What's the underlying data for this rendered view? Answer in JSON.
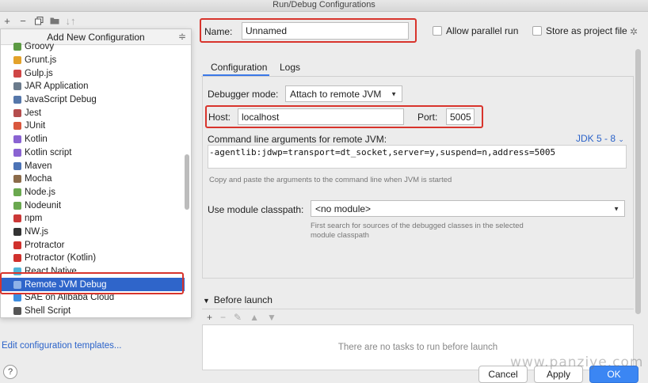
{
  "window": {
    "title": "Run/Debug Configurations"
  },
  "left_toolbar": {
    "icons": [
      "plus-icon",
      "minus-icon",
      "copy-icon",
      "folder-icon",
      "sort-icon"
    ]
  },
  "popup": {
    "title": "Add New Configuration",
    "items": [
      {
        "label": "Groovy",
        "color": "#5c9a43"
      },
      {
        "label": "Grunt.js",
        "color": "#e3a22a"
      },
      {
        "label": "Gulp.js",
        "color": "#cf4646"
      },
      {
        "label": "JAR Application",
        "color": "#6b7b8c"
      },
      {
        "label": "JavaScript Debug",
        "color": "#5577aa"
      },
      {
        "label": "Jest",
        "color": "#b44d4d"
      },
      {
        "label": "JUnit",
        "color": "#d9573e"
      },
      {
        "label": "Kotlin",
        "color": "#8a63d2"
      },
      {
        "label": "Kotlin script",
        "color": "#8a63d2"
      },
      {
        "label": "Maven",
        "color": "#4c73b6"
      },
      {
        "label": "Mocha",
        "color": "#8b6b4a"
      },
      {
        "label": "Node.js",
        "color": "#6aa84f"
      },
      {
        "label": "Nodeunit",
        "color": "#6aa84f"
      },
      {
        "label": "npm",
        "color": "#cb3837"
      },
      {
        "label": "NW.js",
        "color": "#333333"
      },
      {
        "label": "Protractor",
        "color": "#d0312d"
      },
      {
        "label": "Protractor (Kotlin)",
        "color": "#d0312d"
      },
      {
        "label": "React Native",
        "color": "#4fb5d8"
      },
      {
        "label": "Remote JVM Debug",
        "color": "#8fb2e8"
      },
      {
        "label": "SAE on Alibaba Cloud",
        "color": "#3d8de0"
      },
      {
        "label": "Shell Script",
        "color": "#555555"
      }
    ],
    "selected_index": 18
  },
  "templates_link": "Edit configuration templates...",
  "help": "?",
  "name_label": "Name:",
  "name_value": "Unnamed",
  "allow_parallel": "Allow parallel run",
  "store_project": "Store as project file",
  "tabs": [
    "Configuration",
    "Logs"
  ],
  "debugger_mode_label": "Debugger mode:",
  "debugger_mode_value": "Attach to remote JVM",
  "host_label": "Host:",
  "host_value": "localhost",
  "port_label": "Port:",
  "port_value": "5005",
  "cmd_label": "Command line arguments for remote JVM:",
  "jdk_link": "JDK 5 - 8",
  "cmd_value": "-agentlib:jdwp=transport=dt_socket,server=y,suspend=n,address=5005",
  "cmd_hint": "Copy and paste the arguments to the command line when JVM is started",
  "module_label": "Use module classpath:",
  "module_value": "<no module>",
  "module_hint_1": "First search for sources of the debugged classes in the selected",
  "module_hint_2": "module classpath",
  "before_launch": "Before launch",
  "before_launch_empty": "There are no tasks to run before launch",
  "buttons": {
    "cancel": "Cancel",
    "apply": "Apply",
    "ok": "OK"
  },
  "watermark": "www.panziye.com"
}
